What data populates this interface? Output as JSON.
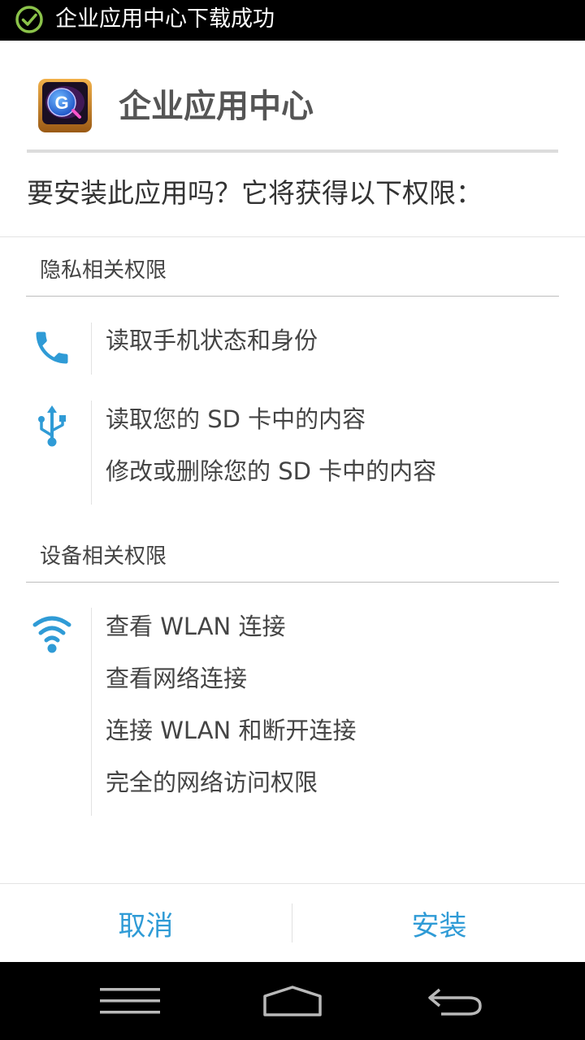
{
  "status_bar": {
    "notification_icon": "check-circle-icon",
    "notification_text": "企业应用中心下载成功",
    "icon_color": "#8BC34A"
  },
  "app": {
    "icon": "app-logo-g-icon",
    "name": "企业应用中心"
  },
  "install_prompt": "要安装此应用吗？它将获得以下权限：",
  "sections": [
    {
      "title": "隐私相关权限",
      "groups": [
        {
          "icon": "phone-icon",
          "items": [
            "读取手机状态和身份"
          ]
        },
        {
          "icon": "usb-icon",
          "items": [
            "读取您的 SD 卡中的内容",
            "修改或删除您的 SD 卡中的内容"
          ]
        }
      ]
    },
    {
      "title": "设备相关权限",
      "groups": [
        {
          "icon": "wifi-icon",
          "items": [
            "查看 WLAN 连接",
            "查看网络连接",
            "连接 WLAN 和断开连接",
            "完全的网络访问权限"
          ]
        }
      ]
    }
  ],
  "buttons": {
    "cancel": "取消",
    "install": "安装"
  },
  "nav_bar": {
    "menu_icon": "menu-icon",
    "home_icon": "home-icon",
    "back_icon": "back-icon"
  },
  "colors": {
    "accent": "#2F9BD6",
    "text_primary": "#333333",
    "text_secondary": "#444444"
  }
}
